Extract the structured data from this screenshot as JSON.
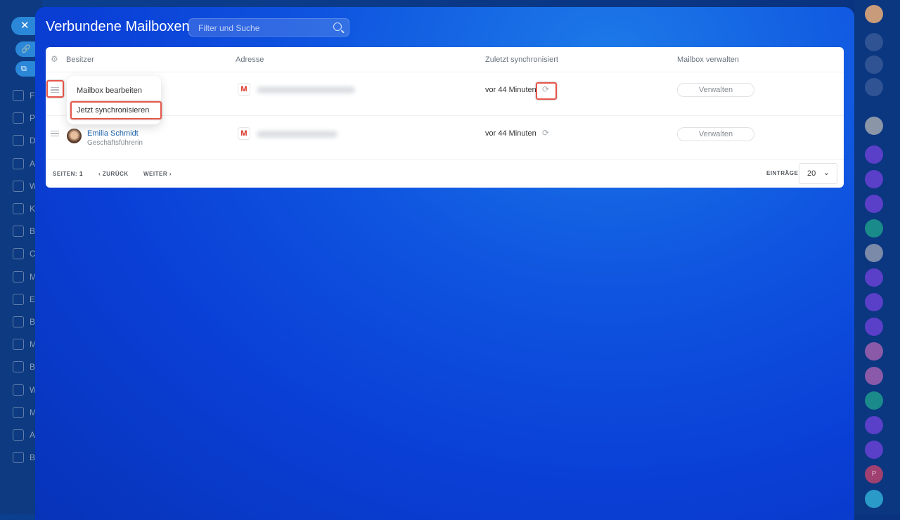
{
  "panel": {
    "title": "Verbundene Mailboxen",
    "search_placeholder": "Filter und Suche"
  },
  "table": {
    "headers": {
      "owner": "Besitzer",
      "address": "Adresse",
      "last_sync": "Zuletzt synchronisiert",
      "manage": "Mailbox verwalten"
    },
    "rows": [
      {
        "owner_name": "",
        "owner_title": "",
        "last_sync": "vor 44 Minuten",
        "manage_label": "Verwalten"
      },
      {
        "owner_name": "Emilia Schmidt",
        "owner_title": "Geschäftsführerin",
        "last_sync": "vor 44 Minuten",
        "manage_label": "Verwalten"
      }
    ],
    "context_menu": [
      "Mailbox bearbeiten",
      "Jetzt synchronisieren"
    ]
  },
  "footer": {
    "pages_label": "SEITEN:",
    "page": "1",
    "prev": "ZURÜCK",
    "next": "WEITER",
    "entries_label": "EINTRÄGE",
    "entries_value": "20"
  },
  "left_sidebar": {
    "letters": [
      "F",
      "P",
      "D",
      "A",
      "W",
      "K",
      "B",
      "C",
      "M",
      "E",
      "B",
      "M",
      "B",
      "W",
      "M",
      "A",
      "B"
    ]
  },
  "right_sidebar": {
    "badge_letter": "P"
  },
  "colors": {
    "highlight": "#e8564a",
    "link": "#2066b0"
  }
}
